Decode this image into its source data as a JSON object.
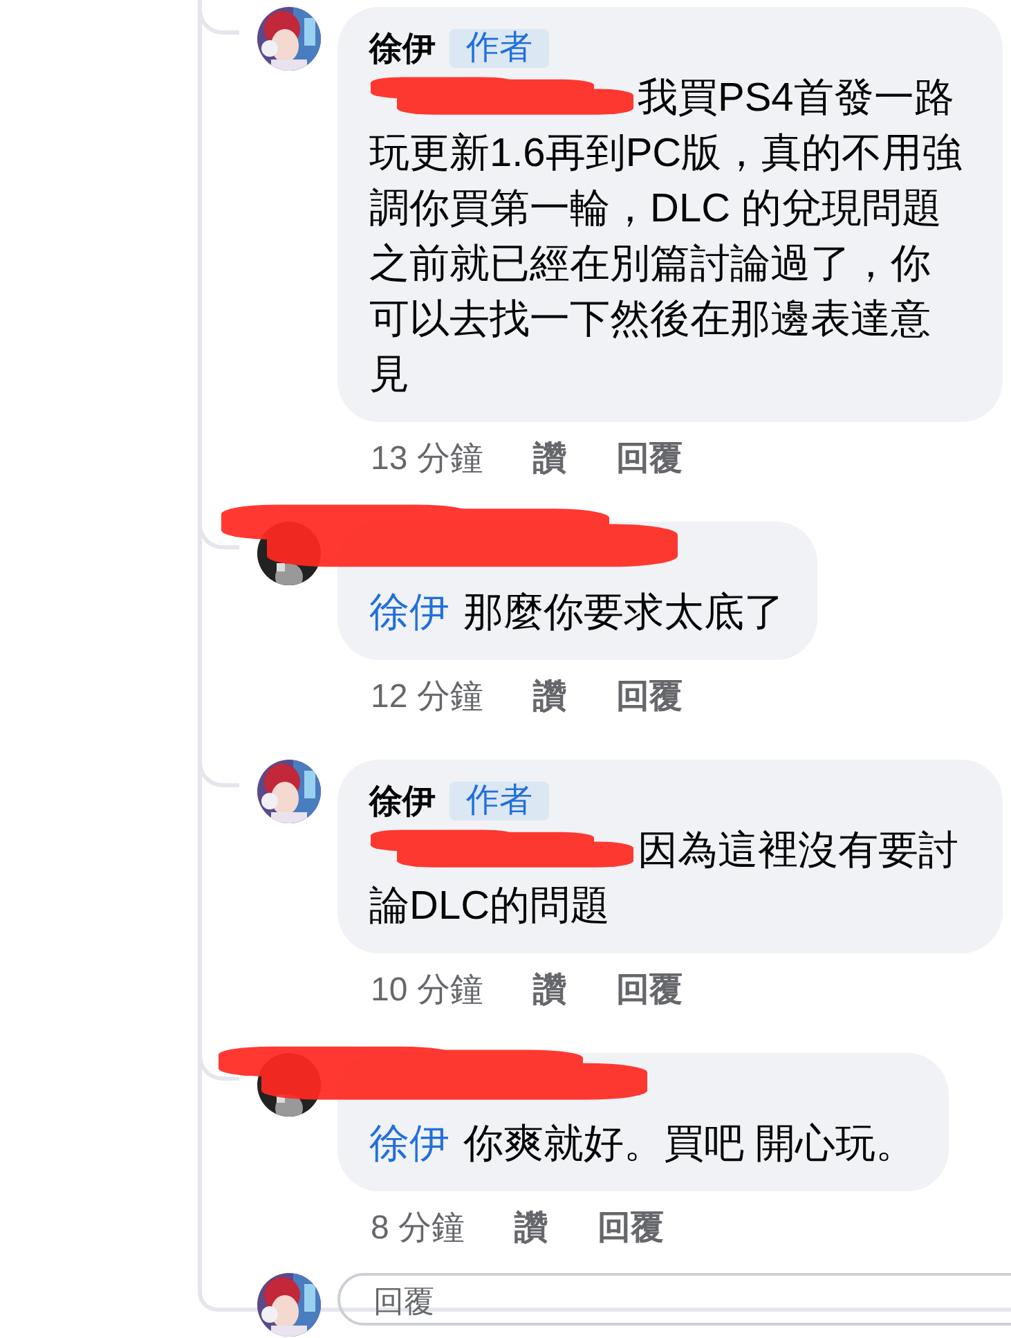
{
  "comments": [
    {
      "kind": "author",
      "name": "徐伊",
      "badge": "作者",
      "redacted": true,
      "text": "我買PS4首發一路玩更新1.6再到PC版，真的不用強調你買第一輪，DLC 的兌現問題之前就已經在別篇討論過了，你可以去找一下然後在那邊表達意見",
      "time": "13 分鐘",
      "like": "讚",
      "reply": "回覆"
    },
    {
      "kind": "other",
      "redacted": true,
      "mention": "徐伊",
      "text": "那麼你要求太底了",
      "time": "12 分鐘",
      "like": "讚",
      "reply": "回覆"
    },
    {
      "kind": "author",
      "name": "徐伊",
      "badge": "作者",
      "redacted": true,
      "text": "因為這裡沒有要討論DLC的問題",
      "time": "10 分鐘",
      "like": "讚",
      "reply": "回覆"
    },
    {
      "kind": "other",
      "redacted": true,
      "mention": "徐伊",
      "text": "你爽就好。買吧 開心玩。",
      "time": "8 分鐘",
      "like": "讚",
      "reply": "回覆"
    }
  ],
  "reply_field": {
    "placeholder": "回覆"
  }
}
